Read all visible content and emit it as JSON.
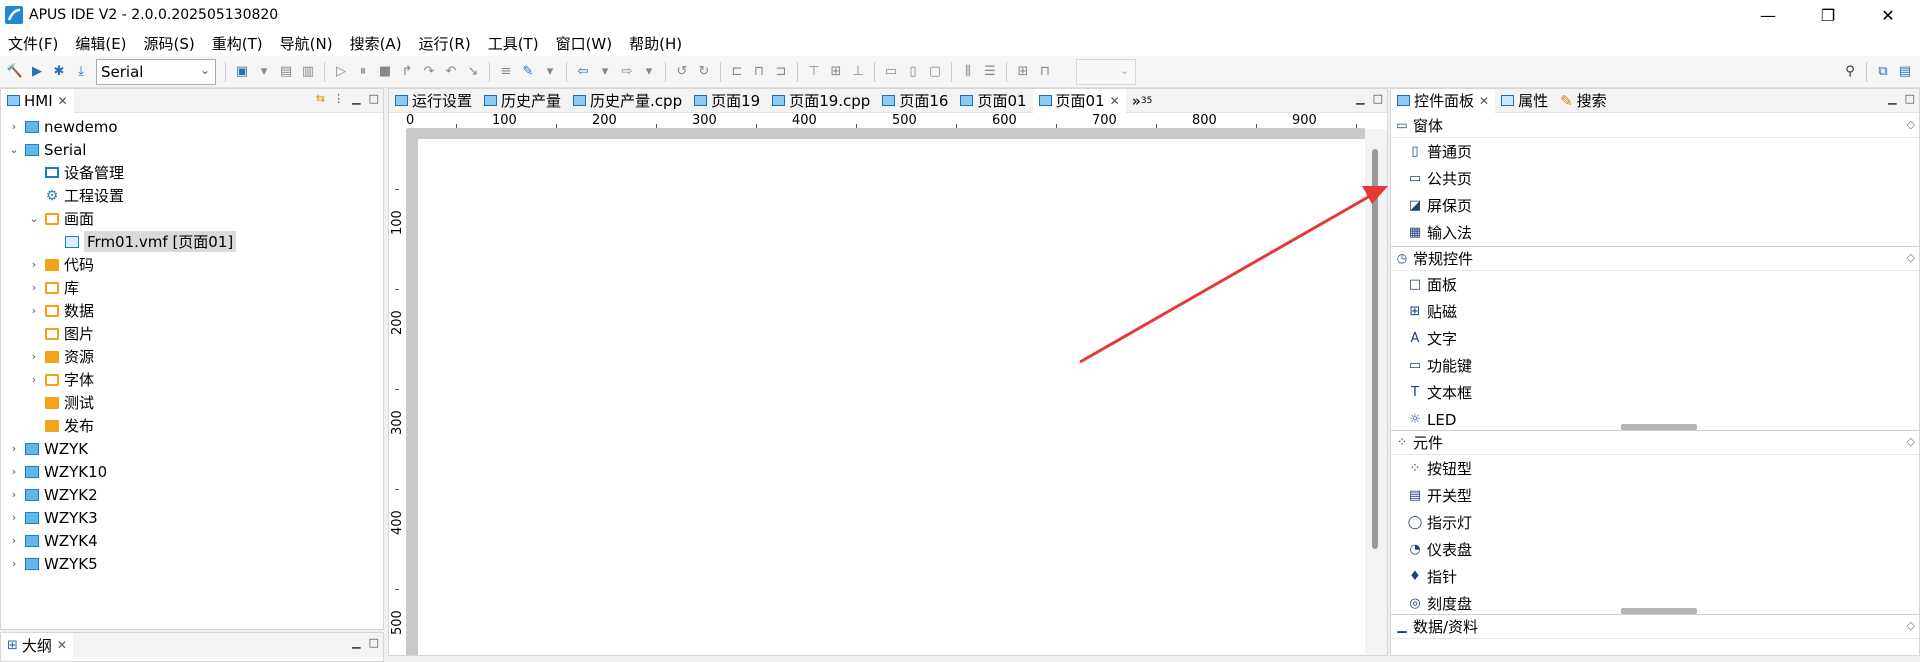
{
  "window": {
    "title": "APUS IDE V2 - 2.0.0.202505130820",
    "minimize_glyph": "—",
    "maximize_glyph": "❐",
    "close_glyph": "✕"
  },
  "menu": [
    "文件(F)",
    "编辑(E)",
    "源码(S)",
    "重构(T)",
    "导航(N)",
    "搜索(A)",
    "运行(R)",
    "工具(T)",
    "窗口(W)",
    "帮助(H)"
  ],
  "toolbar": {
    "target_select": "Serial"
  },
  "hmi": {
    "tab_label": "HMI",
    "tree": [
      {
        "label": "newdemo",
        "twisty": "›",
        "icon": "proj",
        "indent": 0
      },
      {
        "label": "Serial",
        "twisty": "⌄",
        "icon": "proj",
        "indent": 0
      },
      {
        "label": "设备管理",
        "twisty": "",
        "icon": "screen",
        "indent": 1
      },
      {
        "label": "工程设置",
        "twisty": "",
        "icon": "gear",
        "indent": 1
      },
      {
        "label": "画面",
        "twisty": "⌄",
        "icon": "folder-outline",
        "indent": 1
      },
      {
        "label": "Frm01.vmf [页面01]",
        "twisty": "",
        "icon": "file",
        "indent": 2,
        "selected": true
      },
      {
        "label": "代码",
        "twisty": "›",
        "icon": "folder",
        "indent": 1
      },
      {
        "label": "库",
        "twisty": "›",
        "icon": "folder-outline",
        "indent": 1
      },
      {
        "label": "数据",
        "twisty": "›",
        "icon": "folder-outline",
        "indent": 1
      },
      {
        "label": "图片",
        "twisty": "",
        "icon": "folder-outline",
        "indent": 1
      },
      {
        "label": "资源",
        "twisty": "›",
        "icon": "folder",
        "indent": 1
      },
      {
        "label": "字体",
        "twisty": "›",
        "icon": "folder-outline",
        "indent": 1
      },
      {
        "label": "测试",
        "twisty": "",
        "icon": "folder",
        "indent": 1
      },
      {
        "label": "发布",
        "twisty": "",
        "icon": "folder",
        "indent": 1
      },
      {
        "label": "WZYK",
        "twisty": "›",
        "icon": "proj",
        "indent": 0
      },
      {
        "label": "WZYK10",
        "twisty": "›",
        "icon": "proj",
        "indent": 0
      },
      {
        "label": "WZYK2",
        "twisty": "›",
        "icon": "proj",
        "indent": 0
      },
      {
        "label": "WZYK3",
        "twisty": "›",
        "icon": "proj",
        "indent": 0
      },
      {
        "label": "WZYK4",
        "twisty": "›",
        "icon": "proj",
        "indent": 0
      },
      {
        "label": "WZYK5",
        "twisty": "›",
        "icon": "proj",
        "indent": 0
      }
    ]
  },
  "outline": {
    "tab_label": "大纲"
  },
  "editor": {
    "tabs": [
      "运行设置",
      "历史产量",
      "历史产量.cpp",
      "页面19",
      "页面19.cpp",
      "页面16",
      "页面01",
      "页面01"
    ],
    "active_tab": 7,
    "overflow_label": "»",
    "overflow_count": "35",
    "ruler_h": [
      "0",
      "100",
      "200",
      "300",
      "400",
      "500",
      "600",
      "700",
      "800",
      "900"
    ],
    "ruler_v": [
      "100",
      "200",
      "300",
      "400",
      "500"
    ]
  },
  "right": {
    "tabs": [
      "控件面板",
      "属性",
      "搜索"
    ],
    "palette": [
      {
        "title": "窗体",
        "icon": "▭",
        "items": [
          {
            "label": "普通页",
            "icon": "▯"
          },
          {
            "label": "公共页",
            "icon": "▭"
          },
          {
            "label": "屏保页",
            "icon": "◪"
          },
          {
            "label": "输入法",
            "icon": "▦"
          }
        ]
      },
      {
        "title": "常规控件",
        "icon": "◷",
        "items": [
          {
            "label": "面板",
            "icon": "□"
          },
          {
            "label": "贴磁",
            "icon": "⊞"
          },
          {
            "label": "文字",
            "icon": "A"
          },
          {
            "label": "功能键",
            "icon": "▭"
          },
          {
            "label": "文本框",
            "icon": "T"
          },
          {
            "label": "LED",
            "icon": "☼"
          }
        ]
      },
      {
        "title": "元件",
        "icon": "⁘",
        "items": [
          {
            "label": "按钮型",
            "icon": "⁘"
          },
          {
            "label": "开关型",
            "icon": "▤"
          },
          {
            "label": "指示灯",
            "icon": "◯"
          },
          {
            "label": "仪表盘",
            "icon": "◔"
          },
          {
            "label": "指针",
            "icon": "♦"
          },
          {
            "label": "刻度盘",
            "icon": "◎"
          }
        ]
      },
      {
        "title": "数据/资料",
        "icon": "▁",
        "items": []
      }
    ]
  },
  "colors": {
    "accent": "#1c7bc2",
    "folder": "#f3a31b",
    "annotation_arrow": "#e53935"
  }
}
